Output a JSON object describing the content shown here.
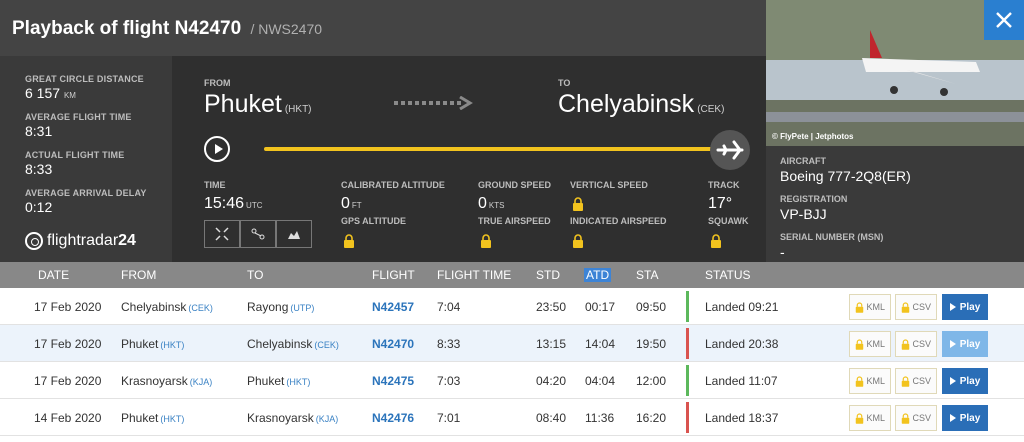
{
  "header": {
    "title": "Playback of flight N42470",
    "subtitle": "/ NWS2470"
  },
  "stats": [
    {
      "label": "GREAT CIRCLE DISTANCE",
      "value": "6 157",
      "unit": "KM"
    },
    {
      "label": "AVERAGE FLIGHT TIME",
      "value": "8:31",
      "unit": ""
    },
    {
      "label": "ACTUAL FLIGHT TIME",
      "value": "8:33",
      "unit": ""
    },
    {
      "label": "AVERAGE ARRIVAL DELAY",
      "value": "0:12",
      "unit": ""
    }
  ],
  "logo": {
    "text": "flightradar",
    "num": "24"
  },
  "route": {
    "from_label": "FROM",
    "from_city": "Phuket",
    "from_code": "(HKT)",
    "to_label": "TO",
    "to_city": "Chelyabinsk",
    "to_code": "(CEK)"
  },
  "metrics": {
    "time_label": "TIME",
    "time_value": "15:46",
    "time_unit": "UTC",
    "cal_alt_label": "CALIBRATED ALTITUDE",
    "cal_alt_value": "0",
    "cal_alt_unit": "FT",
    "gps_alt_label": "GPS ALTITUDE",
    "gs_label": "GROUND SPEED",
    "gs_value": "0",
    "gs_unit": "KTS",
    "tas_label": "TRUE AIRSPEED",
    "vs_label": "VERTICAL SPEED",
    "ias_label": "INDICATED AIRSPEED",
    "track_label": "TRACK",
    "track_value": "17°",
    "squawk_label": "SQUAWK"
  },
  "aircraft": {
    "photo_credit": "© FlyPete | Jetphotos",
    "aircraft_label": "AIRCRAFT",
    "aircraft_value": "Boeing 777-2Q8(ER)",
    "reg_label": "REGISTRATION",
    "reg_value": "VP-BJJ",
    "msn_label": "SERIAL NUMBER (MSN)",
    "msn_value": "-"
  },
  "table": {
    "headers": [
      "DATE",
      "FROM",
      "TO",
      "FLIGHT",
      "FLIGHT TIME",
      "STD",
      "ATD",
      "STA",
      "STATUS"
    ],
    "kml_label": "KML",
    "csv_label": "CSV",
    "play_label": "Play",
    "rows": [
      {
        "date": "17 Feb 2020",
        "from": "Chelyabinsk",
        "from_code": "(CEK)",
        "to": "Rayong",
        "to_code": "(UTP)",
        "flight": "N42457",
        "ftime": "7:04",
        "std": "23:50",
        "atd": "00:17",
        "sta": "09:50",
        "status": "Landed 09:21",
        "color": "#5cb85c"
      },
      {
        "date": "17 Feb 2020",
        "from": "Phuket",
        "from_code": "(HKT)",
        "to": "Chelyabinsk",
        "to_code": "(CEK)",
        "flight": "N42470",
        "ftime": "8:33",
        "std": "13:15",
        "atd": "14:04",
        "sta": "19:50",
        "status": "Landed 20:38",
        "color": "#d9534f"
      },
      {
        "date": "17 Feb 2020",
        "from": "Krasnoyarsk",
        "from_code": "(KJA)",
        "to": "Phuket",
        "to_code": "(HKT)",
        "flight": "N42475",
        "ftime": "7:03",
        "std": "04:20",
        "atd": "04:04",
        "sta": "12:00",
        "status": "Landed 11:07",
        "color": "#5cb85c"
      },
      {
        "date": "14 Feb 2020",
        "from": "Phuket",
        "from_code": "(HKT)",
        "to": "Krasnoyarsk",
        "to_code": "(KJA)",
        "flight": "N42476",
        "ftime": "7:01",
        "std": "08:40",
        "atd": "11:36",
        "sta": "16:20",
        "status": "Landed 18:37",
        "color": "#d9534f"
      }
    ]
  }
}
